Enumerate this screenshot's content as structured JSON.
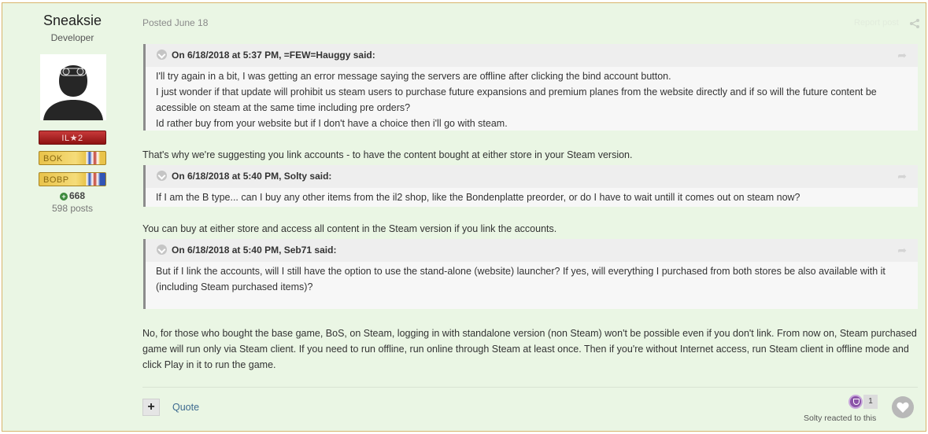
{
  "author": {
    "name": "Sneaksie",
    "title": "Developer",
    "badges": [
      "IL★2",
      "BOK",
      "BOBP"
    ],
    "reputation": "668",
    "posts": "598 posts"
  },
  "post": {
    "date": "Posted June 18",
    "report": "Report post"
  },
  "quotes": [
    {
      "header": "On 6/18/2018 at 5:37 PM, =FEW=Hauggy said:",
      "lines": [
        "I'll try again in a bit, I was getting an error message saying the servers are offline after clicking the bind account button.",
        "I just wonder if that update will prohibit us steam users to purchase future expansions and premium planes from the website directly and if so will the future content be acessible on steam at the same time including pre orders?",
        "Id rather buy from your website but if I don't have a choice then i'll go with steam."
      ]
    },
    {
      "header": "On 6/18/2018 at 5:40 PM, Solty said:",
      "lines": [
        "If I am the B type... can I buy any other items from the il2 shop, like the Bondenplatte preorder, or do I have to wait untill it comes out on steam now?"
      ]
    },
    {
      "header": "On 6/18/2018 at 5:40 PM, Seb71 said:",
      "lines": [
        "But if I link the accounts, will I still have the option to use the stand-alone (website) launcher? If yes, will everything I purchased from both stores be also available with it (including Steam purchased items)?"
      ]
    }
  ],
  "replies": [
    "That's why we're suggesting you link accounts - to have the content bought at either store in your Steam version.",
    "You can buy at either store and access all content in the Steam version if you link the accounts.",
    "No, for those who bought the base game, BoS, on Steam, logging in with standalone version (non Steam) won't be possible even if you don't link. From now on, Steam purchased game will run only via Steam client. If you need to run offline, run online through Steam at least once. Then if you're without Internet access, run Steam client in offline mode and click Play in it to run the game."
  ],
  "footer": {
    "plus": "+",
    "quote": "Quote",
    "reaction_count": "1",
    "reacted_text": "Solty reacted to this"
  }
}
